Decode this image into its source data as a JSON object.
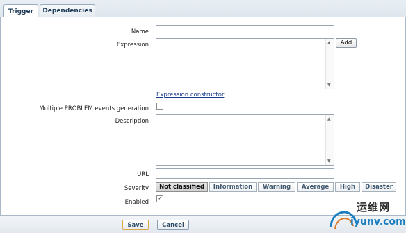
{
  "tabs": [
    {
      "label": "Trigger",
      "active": true
    },
    {
      "label": "Dependencies",
      "active": false
    }
  ],
  "form": {
    "name_label": "Name",
    "name_value": "",
    "expression_label": "Expression",
    "expression_value": "",
    "add_button": "Add",
    "expression_constructor_link": "Expression constructor",
    "multiple_events_label": "Multiple PROBLEM events generation",
    "multiple_events_checked": false,
    "description_label": "Description",
    "description_value": "",
    "url_label": "URL",
    "url_value": "",
    "severity_label": "Severity",
    "severity_options": [
      "Not classified",
      "Information",
      "Warning",
      "Average",
      "High",
      "Disaster"
    ],
    "severity_selected": "Not classified",
    "enabled_label": "Enabled",
    "enabled_checked": true,
    "enabled_mark": "✓"
  },
  "footer": {
    "save_label": "Save",
    "cancel_label": "Cancel"
  },
  "watermark": {
    "cn_text": "运维网",
    "en_text": "iyunv.com"
  }
}
